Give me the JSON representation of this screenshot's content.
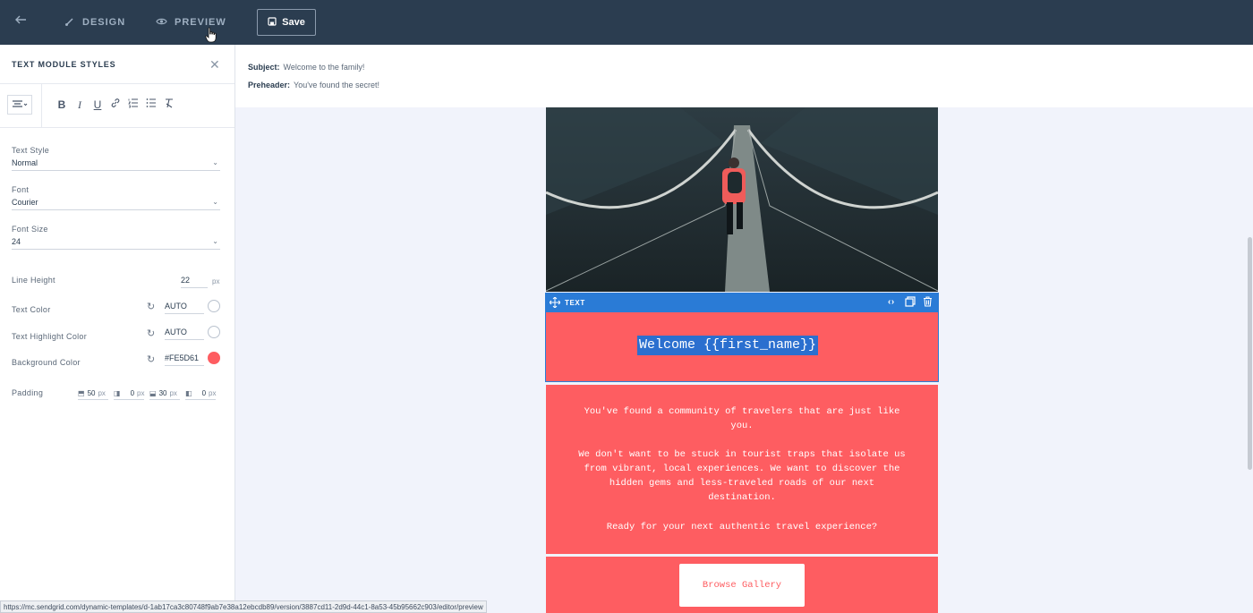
{
  "topbar": {
    "back_icon": "arrow-left-icon",
    "design_label": "DESIGN",
    "preview_label": "PREVIEW",
    "save_label": "Save"
  },
  "panel": {
    "title": "TEXT MODULE STYLES",
    "text_style": {
      "label": "Text Style",
      "value": "Normal"
    },
    "font": {
      "label": "Font",
      "value": "Courier"
    },
    "font_size": {
      "label": "Font Size",
      "value": "24"
    },
    "line_height": {
      "label": "Line Height",
      "value": "22",
      "unit": "px"
    },
    "text_color": {
      "label": "Text Color",
      "value": "AUTO"
    },
    "highlight_color": {
      "label": "Text Highlight Color",
      "value": "AUTO"
    },
    "background_color": {
      "label": "Background Color",
      "value": "#FE5D61"
    },
    "padding": {
      "label": "Padding",
      "top": "50",
      "right": "0",
      "bottom": "30",
      "left": "0",
      "unit": "px"
    }
  },
  "meta": {
    "subject_label": "Subject:",
    "subject": "Welcome to the family!",
    "preheader_label": "Preheader:",
    "preheader": "You've found the secret!"
  },
  "email": {
    "text_block_label": "TEXT",
    "welcome": "Welcome {{first_name}}",
    "para1": "You've found a community of travelers that are just like you.",
    "para2": "We don't want to be stuck in tourist traps that isolate us from vibrant, local experiences. We want to discover the hidden gems and less-traveled roads of our next destination.",
    "para3": "Ready for your next authentic travel experience?",
    "button": "Browse Gallery"
  },
  "status_url": "https://mc.sendgrid.com/dynamic-templates/d-1ab17ca3c80748f9ab7e38a12ebcdb89/version/3887cd11-2d9d-44c1-8a53-45b95662c903/editor/preview",
  "colors": {
    "topbar": "#2b3d50",
    "accent": "#2a7bd6",
    "brand_coral": "#fe5d61"
  }
}
